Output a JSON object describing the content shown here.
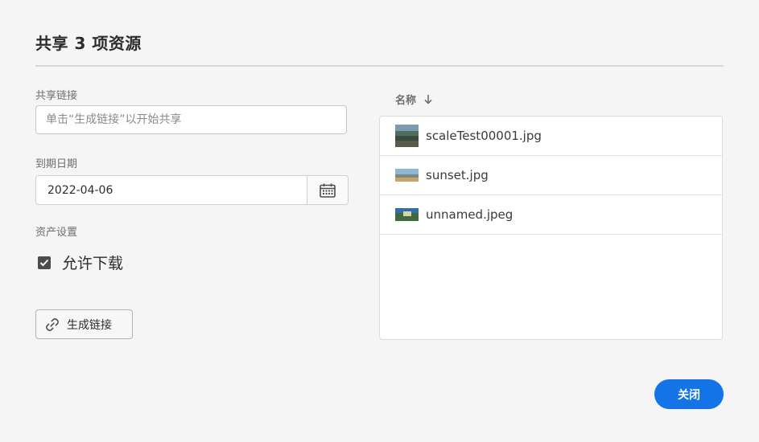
{
  "dialog": {
    "title": "共享 3 项资源"
  },
  "share_link": {
    "label": "共享链接",
    "placeholder": "单击“生成链接”以开始共享",
    "value": ""
  },
  "expiry": {
    "label": "到期日期",
    "value": "2022-04-06",
    "calendar_icon": "calendar-icon"
  },
  "asset_settings": {
    "label": "资产设置",
    "allow_download": {
      "label": "允许下载",
      "checked": true
    }
  },
  "generate_button": {
    "label": "生成链接",
    "icon": "link-icon"
  },
  "file_list": {
    "column_header": "名称",
    "sort_icon": "arrow-down-icon",
    "files": [
      {
        "name": "scaleTest00001.jpg"
      },
      {
        "name": "sunset.jpg"
      },
      {
        "name": "unnamed.jpeg"
      }
    ]
  },
  "close_button": {
    "label": "关闭"
  },
  "colors": {
    "accent": "#1473e6",
    "background": "#f5f5f5",
    "checkbox": "#4b4b4b"
  }
}
